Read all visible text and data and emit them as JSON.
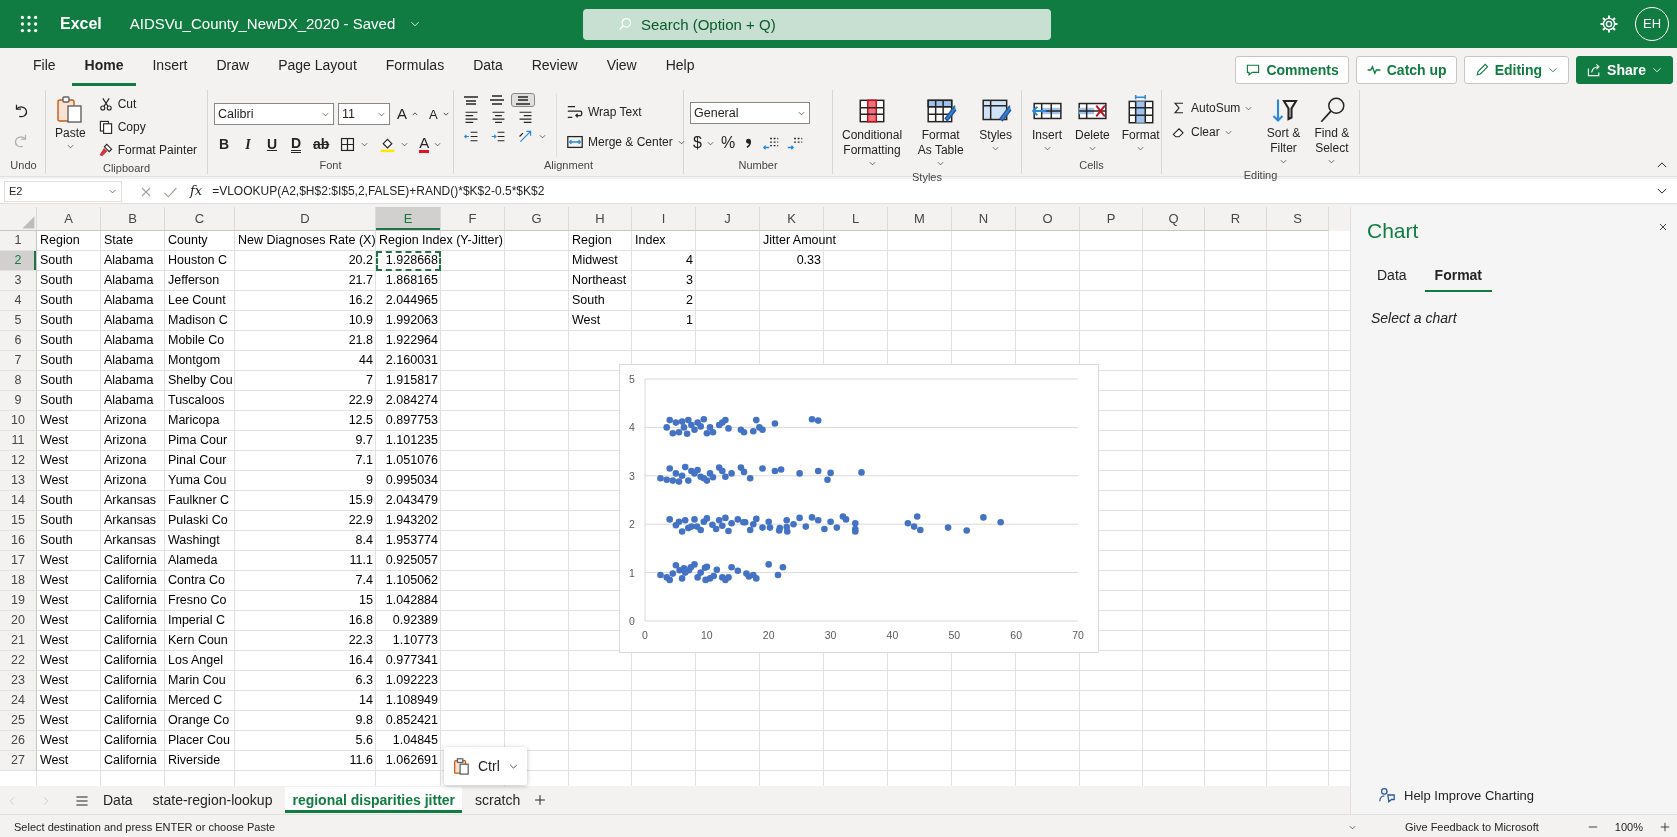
{
  "title_bar": {
    "app_name": "Excel",
    "document_title": "AIDSVu_County_NewDX_2020 - Saved",
    "search_placeholder": "Search (Option + Q)",
    "avatar_initials": "EH"
  },
  "ribbon_tabs": [
    {
      "label": "File",
      "selected": false
    },
    {
      "label": "Home",
      "selected": true
    },
    {
      "label": "Insert",
      "selected": false
    },
    {
      "label": "Draw",
      "selected": false
    },
    {
      "label": "Page Layout",
      "selected": false
    },
    {
      "label": "Formulas",
      "selected": false
    },
    {
      "label": "Data",
      "selected": false
    },
    {
      "label": "Review",
      "selected": false
    },
    {
      "label": "View",
      "selected": false
    },
    {
      "label": "Help",
      "selected": false
    }
  ],
  "ribbon_actions": [
    {
      "label": "Comments",
      "kind": "comments"
    },
    {
      "label": "Catch up",
      "kind": "catch_up"
    },
    {
      "label": "Editing",
      "kind": "editing"
    },
    {
      "label": "Share",
      "kind": "share"
    }
  ],
  "ribbon_groups": [
    {
      "kind": "undo",
      "label": "Undo"
    },
    {
      "kind": "clipboard",
      "label": "Clipboard",
      "paste": "Paste",
      "cut": "Cut",
      "copy": "Copy",
      "format_painter": "Format Painter"
    },
    {
      "kind": "font",
      "label": "Font",
      "font_name": "Calibri",
      "font_size": "11",
      "grow_font": "A",
      "shrink_font": "A",
      "bold": "B",
      "italic": "I",
      "underline": "U",
      "double_underline": "D",
      "strikethrough": "ab",
      "font_color": "A"
    },
    {
      "kind": "alignment",
      "label": "Alignment",
      "vertical_align": [
        {
          "selected": false
        },
        {
          "selected": false
        },
        {
          "selected": true
        }
      ],
      "wrap_text": "Wrap Text",
      "merge": "Merge & Center"
    },
    {
      "kind": "number",
      "label": "Number",
      "format": "General",
      "currency": "$",
      "percent": "%"
    },
    {
      "kind": "styles",
      "label": "Styles",
      "buttons": [
        "Conditional Formatting",
        "Format As Table",
        "Styles"
      ]
    },
    {
      "kind": "cells",
      "label": "Cells",
      "buttons": [
        "Insert",
        "Delete",
        "Format"
      ]
    },
    {
      "kind": "editing",
      "label": "Editing",
      "autosum": "AutoSum",
      "clear": "Clear",
      "buttons": [
        "Sort & Filter",
        "Find & Select"
      ]
    }
  ],
  "formula_bar": {
    "name_box": "E2",
    "fx": "fx",
    "formula": "=VLOOKUP(A2,$H$2:$I$5,2,FALSE)+RAND()*$K$2-0.5*$K$2"
  },
  "sheet": {
    "columns": [
      {
        "label": "A",
        "selected": false
      },
      {
        "label": "B",
        "selected": false
      },
      {
        "label": "C",
        "selected": false
      },
      {
        "label": "D",
        "selected": false
      },
      {
        "label": "E",
        "selected": true
      },
      {
        "label": "F",
        "selected": false
      },
      {
        "label": "G",
        "selected": false
      },
      {
        "label": "H",
        "selected": false
      },
      {
        "label": "I",
        "selected": false
      },
      {
        "label": "J",
        "selected": false
      },
      {
        "label": "K",
        "selected": false
      },
      {
        "label": "L",
        "selected": false
      },
      {
        "label": "M",
        "selected": false
      },
      {
        "label": "N",
        "selected": false
      },
      {
        "label": "O",
        "selected": false
      },
      {
        "label": "P",
        "selected": false
      },
      {
        "label": "Q",
        "selected": false
      },
      {
        "label": "R",
        "selected": false
      },
      {
        "label": "S",
        "selected": false
      }
    ],
    "rows": [
      {
        "label": "1",
        "selected": false
      },
      {
        "label": "2",
        "selected": true
      },
      {
        "label": "3",
        "selected": false
      },
      {
        "label": "4",
        "selected": false
      },
      {
        "label": "5",
        "selected": false
      },
      {
        "label": "6",
        "selected": false
      },
      {
        "label": "7",
        "selected": false
      },
      {
        "label": "8",
        "selected": false
      },
      {
        "label": "9",
        "selected": false
      },
      {
        "label": "10",
        "selected": false
      },
      {
        "label": "11",
        "selected": false
      },
      {
        "label": "12",
        "selected": false
      },
      {
        "label": "13",
        "selected": false
      },
      {
        "label": "14",
        "selected": false
      },
      {
        "label": "15",
        "selected": false
      },
      {
        "label": "16",
        "selected": false
      },
      {
        "label": "17",
        "selected": false
      },
      {
        "label": "18",
        "selected": false
      },
      {
        "label": "19",
        "selected": false
      },
      {
        "label": "20",
        "selected": false
      },
      {
        "label": "21",
        "selected": false
      },
      {
        "label": "22",
        "selected": false
      },
      {
        "label": "23",
        "selected": false
      },
      {
        "label": "24",
        "selected": false
      },
      {
        "label": "25",
        "selected": false
      },
      {
        "label": "26",
        "selected": false
      },
      {
        "label": "27",
        "selected": false
      }
    ]
  },
  "data_table": [
    [
      "Region",
      "State",
      "County",
      "New Diagnoses Rate (X)",
      "Region Index (Y-Jitter)"
    ],
    [
      "South",
      "Alabama",
      "Houston C",
      "20.2",
      "1.928668"
    ],
    [
      "South",
      "Alabama",
      "Jefferson",
      "21.7",
      "1.868165"
    ],
    [
      "South",
      "Alabama",
      "Lee Count",
      "16.2",
      "2.044965"
    ],
    [
      "South",
      "Alabama",
      "Madison C",
      "10.9",
      "1.992063"
    ],
    [
      "South",
      "Alabama",
      "Mobile Co",
      "21.8",
      "1.922964"
    ],
    [
      "South",
      "Alabama",
      "Montgom",
      "44",
      "2.160031"
    ],
    [
      "South",
      "Alabama",
      "Shelby Cou",
      "7",
      "1.915817"
    ],
    [
      "South",
      "Alabama",
      "Tuscaloos",
      "22.9",
      "2.084274"
    ],
    [
      "West",
      "Arizona",
      "Maricopa",
      "12.5",
      "0.897753"
    ],
    [
      "West",
      "Arizona",
      "Pima Cour",
      "9.7",
      "1.101235"
    ],
    [
      "West",
      "Arizona",
      "Pinal Cour",
      "7.1",
      "1.051076"
    ],
    [
      "West",
      "Arizona",
      "Yuma Cou",
      "9",
      "0.995034"
    ],
    [
      "South",
      "Arkansas",
      "Faulkner C",
      "15.9",
      "2.043479"
    ],
    [
      "South",
      "Arkansas",
      "Pulaski Co",
      "22.9",
      "1.943202"
    ],
    [
      "South",
      "Arkansas",
      "Washingt",
      "8.4",
      "1.953774"
    ],
    [
      "West",
      "California",
      "Alameda",
      "11.1",
      "0.925057"
    ],
    [
      "West",
      "California",
      "Contra Co",
      "7.4",
      "1.105062"
    ],
    [
      "West",
      "California",
      "Fresno Co",
      "15",
      "1.042884"
    ],
    [
      "West",
      "California",
      "Imperial C",
      "16.8",
      "0.92389"
    ],
    [
      "West",
      "California",
      "Kern Coun",
      "22.3",
      "1.10773"
    ],
    [
      "West",
      "California",
      "Los Angel",
      "16.4",
      "0.977341"
    ],
    [
      "West",
      "California",
      "Marin Cou",
      "6.3",
      "1.092223"
    ],
    [
      "West",
      "California",
      "Merced C",
      "14",
      "1.108949"
    ],
    [
      "West",
      "California",
      "Orange Co",
      "9.8",
      "0.852421"
    ],
    [
      "West",
      "California",
      "Placer Cou",
      "5.6",
      "1.04845"
    ],
    [
      "West",
      "California",
      "Riverside",
      "11.6",
      "1.062691"
    ]
  ],
  "lookup_table": [
    [
      "Region",
      "Index"
    ],
    [
      "Midwest",
      "4"
    ],
    [
      "Northeast",
      "3"
    ],
    [
      "South",
      "2"
    ],
    [
      "West",
      "1"
    ]
  ],
  "jitter": {
    "label": "Jitter Amount",
    "value": "0.33"
  },
  "chart": {
    "chart_data": {
      "type": "scatter",
      "grid": true,
      "xlim": [
        0,
        70
      ],
      "ylim": [
        0,
        5
      ],
      "xticks": [
        0,
        10,
        20,
        30,
        40,
        50,
        60,
        70
      ],
      "yticks": [
        0,
        1,
        2,
        3,
        4,
        5
      ],
      "x": [
        3.5,
        4,
        4.5,
        5,
        5.5,
        6,
        6.3,
        6.8,
        7,
        7.5,
        8,
        8.5,
        9,
        9.5,
        10,
        10.5,
        11,
        12,
        12.5,
        13,
        13.5,
        15.5,
        16,
        17.5,
        18,
        18.5,
        19,
        21,
        27,
        28,
        2.5,
        3.5,
        4,
        4.5,
        5,
        5.5,
        6,
        6.5,
        7,
        7.5,
        8,
        8.5,
        9,
        9.5,
        10,
        10.5,
        11,
        12,
        12.5,
        13,
        14,
        15.5,
        16,
        17,
        19,
        21,
        22,
        25,
        28,
        29.5,
        30,
        35,
        20.2,
        21.7,
        16.2,
        10.9,
        21.8,
        44,
        7,
        22.9,
        15.9,
        22.9,
        8.4,
        4,
        5,
        5.5,
        6,
        6.5,
        7.5,
        8,
        9,
        9.5,
        10,
        11.5,
        12,
        12.5,
        13,
        13.5,
        14,
        15,
        17,
        17.5,
        18,
        19,
        20,
        23,
        24,
        25,
        26,
        27,
        28,
        29,
        30,
        31,
        32,
        32.5,
        34,
        34,
        34,
        42.5,
        43.5,
        44.5,
        49,
        52,
        54.7,
        57.5,
        12.5,
        9.7,
        7.1,
        9,
        11.1,
        7.4,
        15,
        16.8,
        22.3,
        16.4,
        6.3,
        14,
        9.8,
        5.6,
        11.6,
        2.5,
        3.5,
        4,
        4.5,
        5,
        6,
        6.5,
        8,
        8.5,
        10,
        10.5,
        13,
        13.5,
        17.5,
        18,
        20,
        21.5
      ],
      "series": [
        {
          "color": "#4472c4",
          "values": [
            4.0,
            4.15,
            3.88,
            4.1,
            3.9,
            4.12,
            4.0,
            3.87,
            4.15,
            4.05,
            3.95,
            4.1,
            4.02,
            4.17,
            3.88,
            4.0,
            3.9,
            4.05,
            4.1,
            4.15,
            3.98,
            3.95,
            3.9,
            3.92,
            4.15,
            4.0,
            3.95,
            4.08,
            4.17,
            4.14,
            2.95,
            2.92,
            3.15,
            2.9,
            3.05,
            2.88,
            3.0,
            3.18,
            2.9,
            3.1,
            3.05,
            3.12,
            2.98,
            2.95,
            2.9,
            3.05,
            2.97,
            3.17,
            3.1,
            2.98,
            3.05,
            3.17,
            3.08,
            2.95,
            3.15,
            3.1,
            3.13,
            3.05,
            3.1,
            2.92,
            3.06,
            3.07,
            1.93,
            1.87,
            2.04,
            1.99,
            1.92,
            2.16,
            1.92,
            2.08,
            2.04,
            1.94,
            1.95,
            2.1,
            1.98,
            2.05,
            1.85,
            2.08,
            1.95,
            2.1,
            1.88,
            2.05,
            2.12,
            1.9,
            2.08,
            1.97,
            2.13,
            1.86,
            2.02,
            2.1,
            1.88,
            2.0,
            2.11,
            1.93,
            2.05,
            1.85,
            2.0,
            2.13,
            1.95,
            2.14,
            2.08,
            1.9,
            2.05,
            1.93,
            2.16,
            2.1,
            1.85,
            2.02,
            1.9,
            2.02,
            1.95,
            1.88,
            1.93,
            1.87,
            2.14,
            2.04,
            0.9,
            1.1,
            1.05,
            1.0,
            0.93,
            1.11,
            1.04,
            0.92,
            1.11,
            0.98,
            1.09,
            1.11,
            0.85,
            1.05,
            1.06,
            0.95,
            0.9,
            0.85,
            0.98,
            1.15,
            0.88,
            1.0,
            1.17,
            0.9,
            1.12,
            0.88,
            0.85,
            0.9,
            0.95,
            0.88,
            1.17,
            0.95
          ]
        }
      ]
    }
  },
  "paste_options": {
    "label": "Ctrl"
  },
  "sheet_tabs": [
    {
      "label": "Data",
      "selected": false
    },
    {
      "label": "state-region-lookup",
      "selected": false
    },
    {
      "label": "regional disparities jitter",
      "selected": true
    },
    {
      "label": "scratch",
      "selected": false
    }
  ],
  "chart_pane": {
    "title": "Chart",
    "tabs": [
      {
        "label": "Data",
        "selected": false
      },
      {
        "label": "Format",
        "selected": true
      }
    ],
    "message": "Select a chart",
    "footer_link": "Help Improve Charting"
  },
  "status_bar": {
    "message": "Select destination and press ENTER or choose Paste",
    "feedback": "Give Feedback to Microsoft",
    "zoom": "100%"
  }
}
